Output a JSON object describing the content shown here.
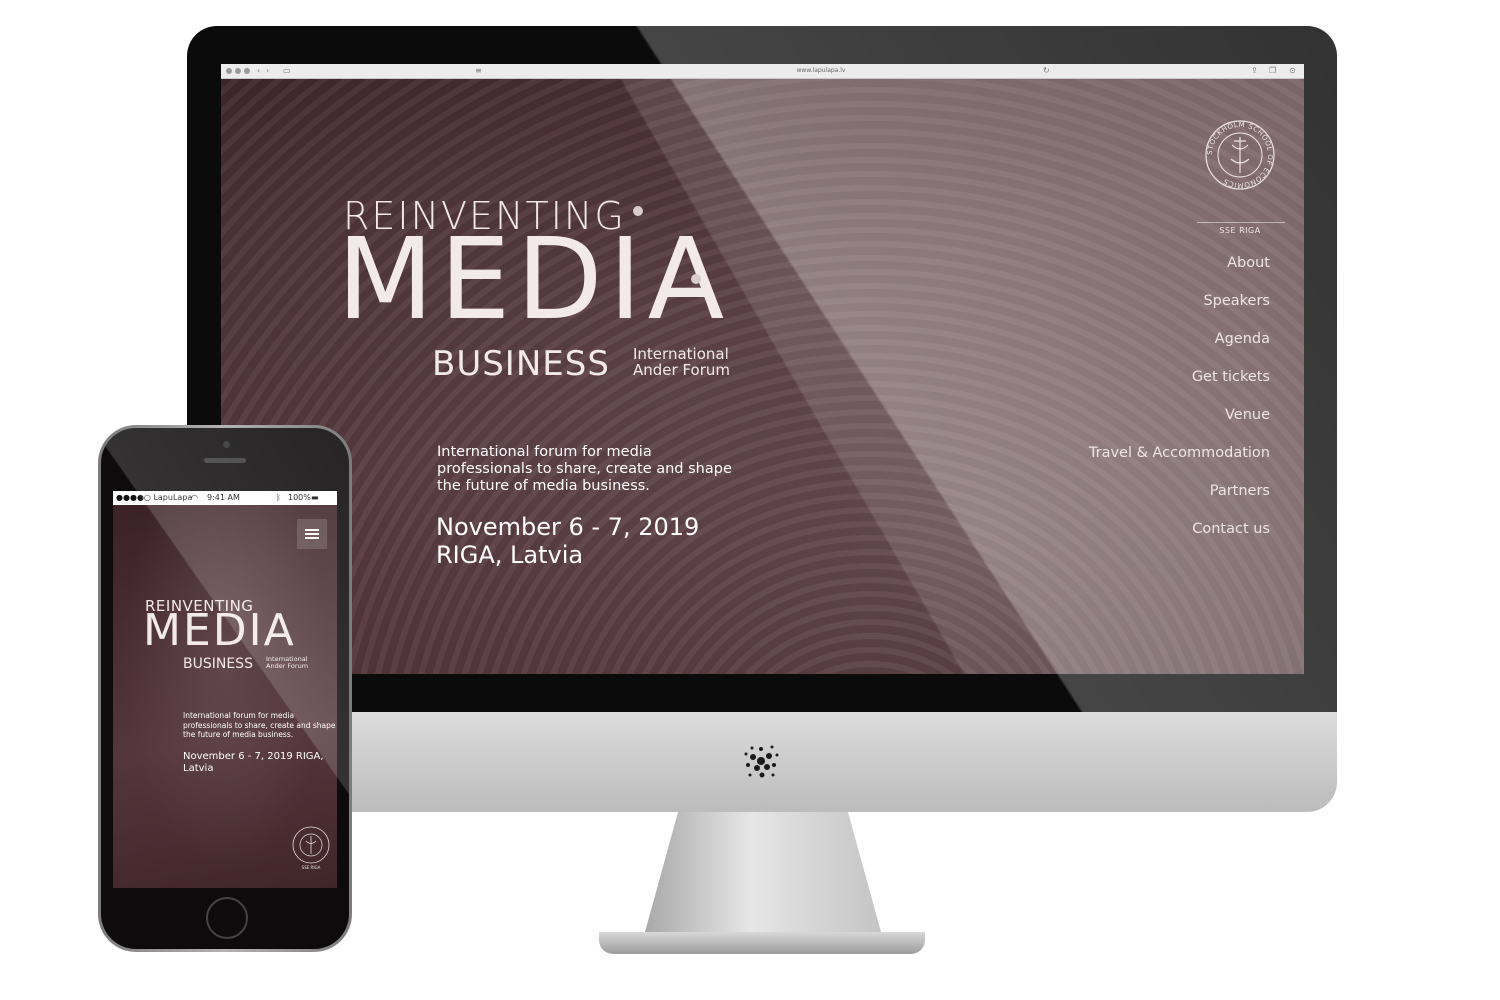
{
  "browser": {
    "url": "www.lapulapa.lv"
  },
  "hero": {
    "reinventing": "REINVENTING",
    "media": "MEDIA",
    "business": "BUSINESS",
    "forum_line1": "International",
    "forum_line2": "Ander Forum",
    "description": "International forum for media professionals to share, create and shape the future of media business.",
    "date_line1": "November 6 - 7, 2019",
    "date_line2": "RIGA, Latvia"
  },
  "nav": {
    "items": [
      {
        "label": "About"
      },
      {
        "label": "Speakers"
      },
      {
        "label": "Agenda"
      },
      {
        "label": "Get tickets"
      },
      {
        "label": "Venue"
      },
      {
        "label": "Travel & Accommodation"
      },
      {
        "label": "Partners"
      },
      {
        "label": "Contact us"
      }
    ]
  },
  "seal": {
    "ring_text": "STOCKHOLM SCHOOL OF ECONOMICS",
    "label": "SSE RIGA"
  },
  "phone": {
    "status": {
      "carrier": "●●●●○ LapuLapa",
      "time": "9:41 AM",
      "battery": "100%"
    },
    "hero": {
      "reinventing": "REINVENTING",
      "media": "MEDIA",
      "business": "BUSINESS",
      "forum_line1": "International",
      "forum_line2": "Ander Forum",
      "description": "International forum for media professionals to share, create and shape the future of media business.",
      "dates": "November 6 - 7, 2019 RIGA, Latvia"
    },
    "seal_label": "SSE RIGA"
  },
  "colors": {
    "brand_background": "#4a2e33",
    "text_light": "#f2eaea"
  }
}
